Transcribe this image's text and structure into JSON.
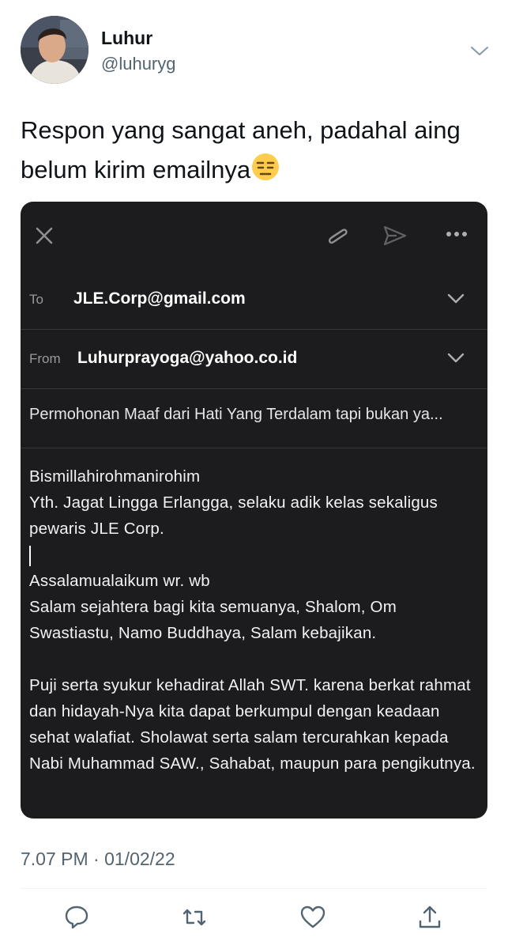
{
  "tweet": {
    "author_name": "Luhur",
    "author_handle": "@luhuryg",
    "text": "Respon yang sangat aneh, padahal aing belum kirim emailnya",
    "emoji": "😑",
    "timestamp": "7.07 PM · 01/02/22"
  },
  "email": {
    "to_label": "To",
    "to_value": "JLE.Corp@gmail.com",
    "from_label": "From",
    "from_value": "Luhurprayoga@yahoo.co.id",
    "subject": "Permohonan Maaf dari Hati Yang Terdalam tapi bukan ya...",
    "body": {
      "greeting": "Bismillahirohmanirohim",
      "recipient": "Yth. Jagat Lingga Erlangga, selaku adik kelas sekaligus pewaris JLE Corp.",
      "salam_1": "Assalamualaikum wr. wb",
      "salam_2": "Salam sejahtera bagi kita semuanya, Shalom, Om Swastiastu, Namo Buddhaya, Salam kebajikan.",
      "paragraph": "Puji serta syukur kehadirat Allah SWT. karena berkat rahmat dan hidayah-Nya kita dapat berkumpul dengan keadaan sehat walafiat. Sholawat serta salam tercurahkan kepada Nabi Muhammad SAW., Sahabat, maupun para pengikutnya."
    }
  },
  "icons": {
    "tweet_menu": "chevron-down-icon",
    "email_toolbar": [
      "close-icon",
      "paperclip-icon",
      "send-icon",
      "more-dots-icon"
    ],
    "actions": [
      "reply-icon",
      "retweet-icon",
      "like-icon",
      "share-icon"
    ]
  },
  "colors": {
    "text_primary": "#0f1419",
    "text_secondary": "#536471",
    "email_bg": "#1c1c1e",
    "email_divider": "#38383a"
  }
}
